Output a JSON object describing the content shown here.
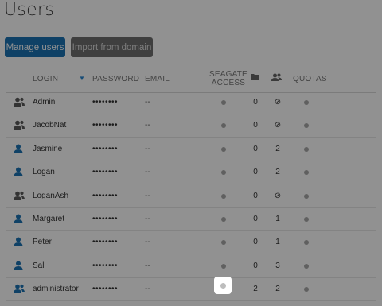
{
  "page": {
    "title": "Users"
  },
  "toolbar": {
    "manage_label": "Manage users",
    "import_label": "Import from domain"
  },
  "table": {
    "headers": {
      "login": "LOGIN",
      "password": "PASSWORD",
      "email": "EMAIL",
      "access_line1": "SEAGATE",
      "access_line2": "ACCESS",
      "quotas": "QUOTAS"
    },
    "rows": [
      {
        "icon": "admin-user-icon",
        "login": "Admin",
        "password": "••••••••",
        "email": "--",
        "folders": "0",
        "groups": "⊘"
      },
      {
        "icon": "admin-user-icon",
        "login": "JacobNat",
        "password": "••••••••",
        "email": "--",
        "folders": "0",
        "groups": "⊘"
      },
      {
        "icon": "user-icon",
        "login": "Jasmine",
        "password": "••••••••",
        "email": "--",
        "folders": "0",
        "groups": "2"
      },
      {
        "icon": "user-icon",
        "login": "Logan",
        "password": "••••••••",
        "email": "--",
        "folders": "0",
        "groups": "2"
      },
      {
        "icon": "admin-user-icon",
        "login": "LoganAsh",
        "password": "••••••••",
        "email": "--",
        "folders": "0",
        "groups": "⊘"
      },
      {
        "icon": "user-icon",
        "login": "Margaret",
        "password": "••••••••",
        "email": "--",
        "folders": "0",
        "groups": "1"
      },
      {
        "icon": "user-icon",
        "login": "Peter",
        "password": "••••••••",
        "email": "--",
        "folders": "0",
        "groups": "1"
      },
      {
        "icon": "user-icon",
        "login": "Sal",
        "password": "••••••••",
        "email": "--",
        "folders": "0",
        "groups": "3"
      },
      {
        "icon": "admin-user-blue-icon",
        "login": "administrator",
        "password": "••••••••",
        "email": "--",
        "folders": "2",
        "groups": "2"
      }
    ]
  },
  "colors": {
    "accent": "#1b73b4",
    "disabled": "#6f6f6f",
    "overlay": "rgba(0,0,0,0.43)"
  }
}
